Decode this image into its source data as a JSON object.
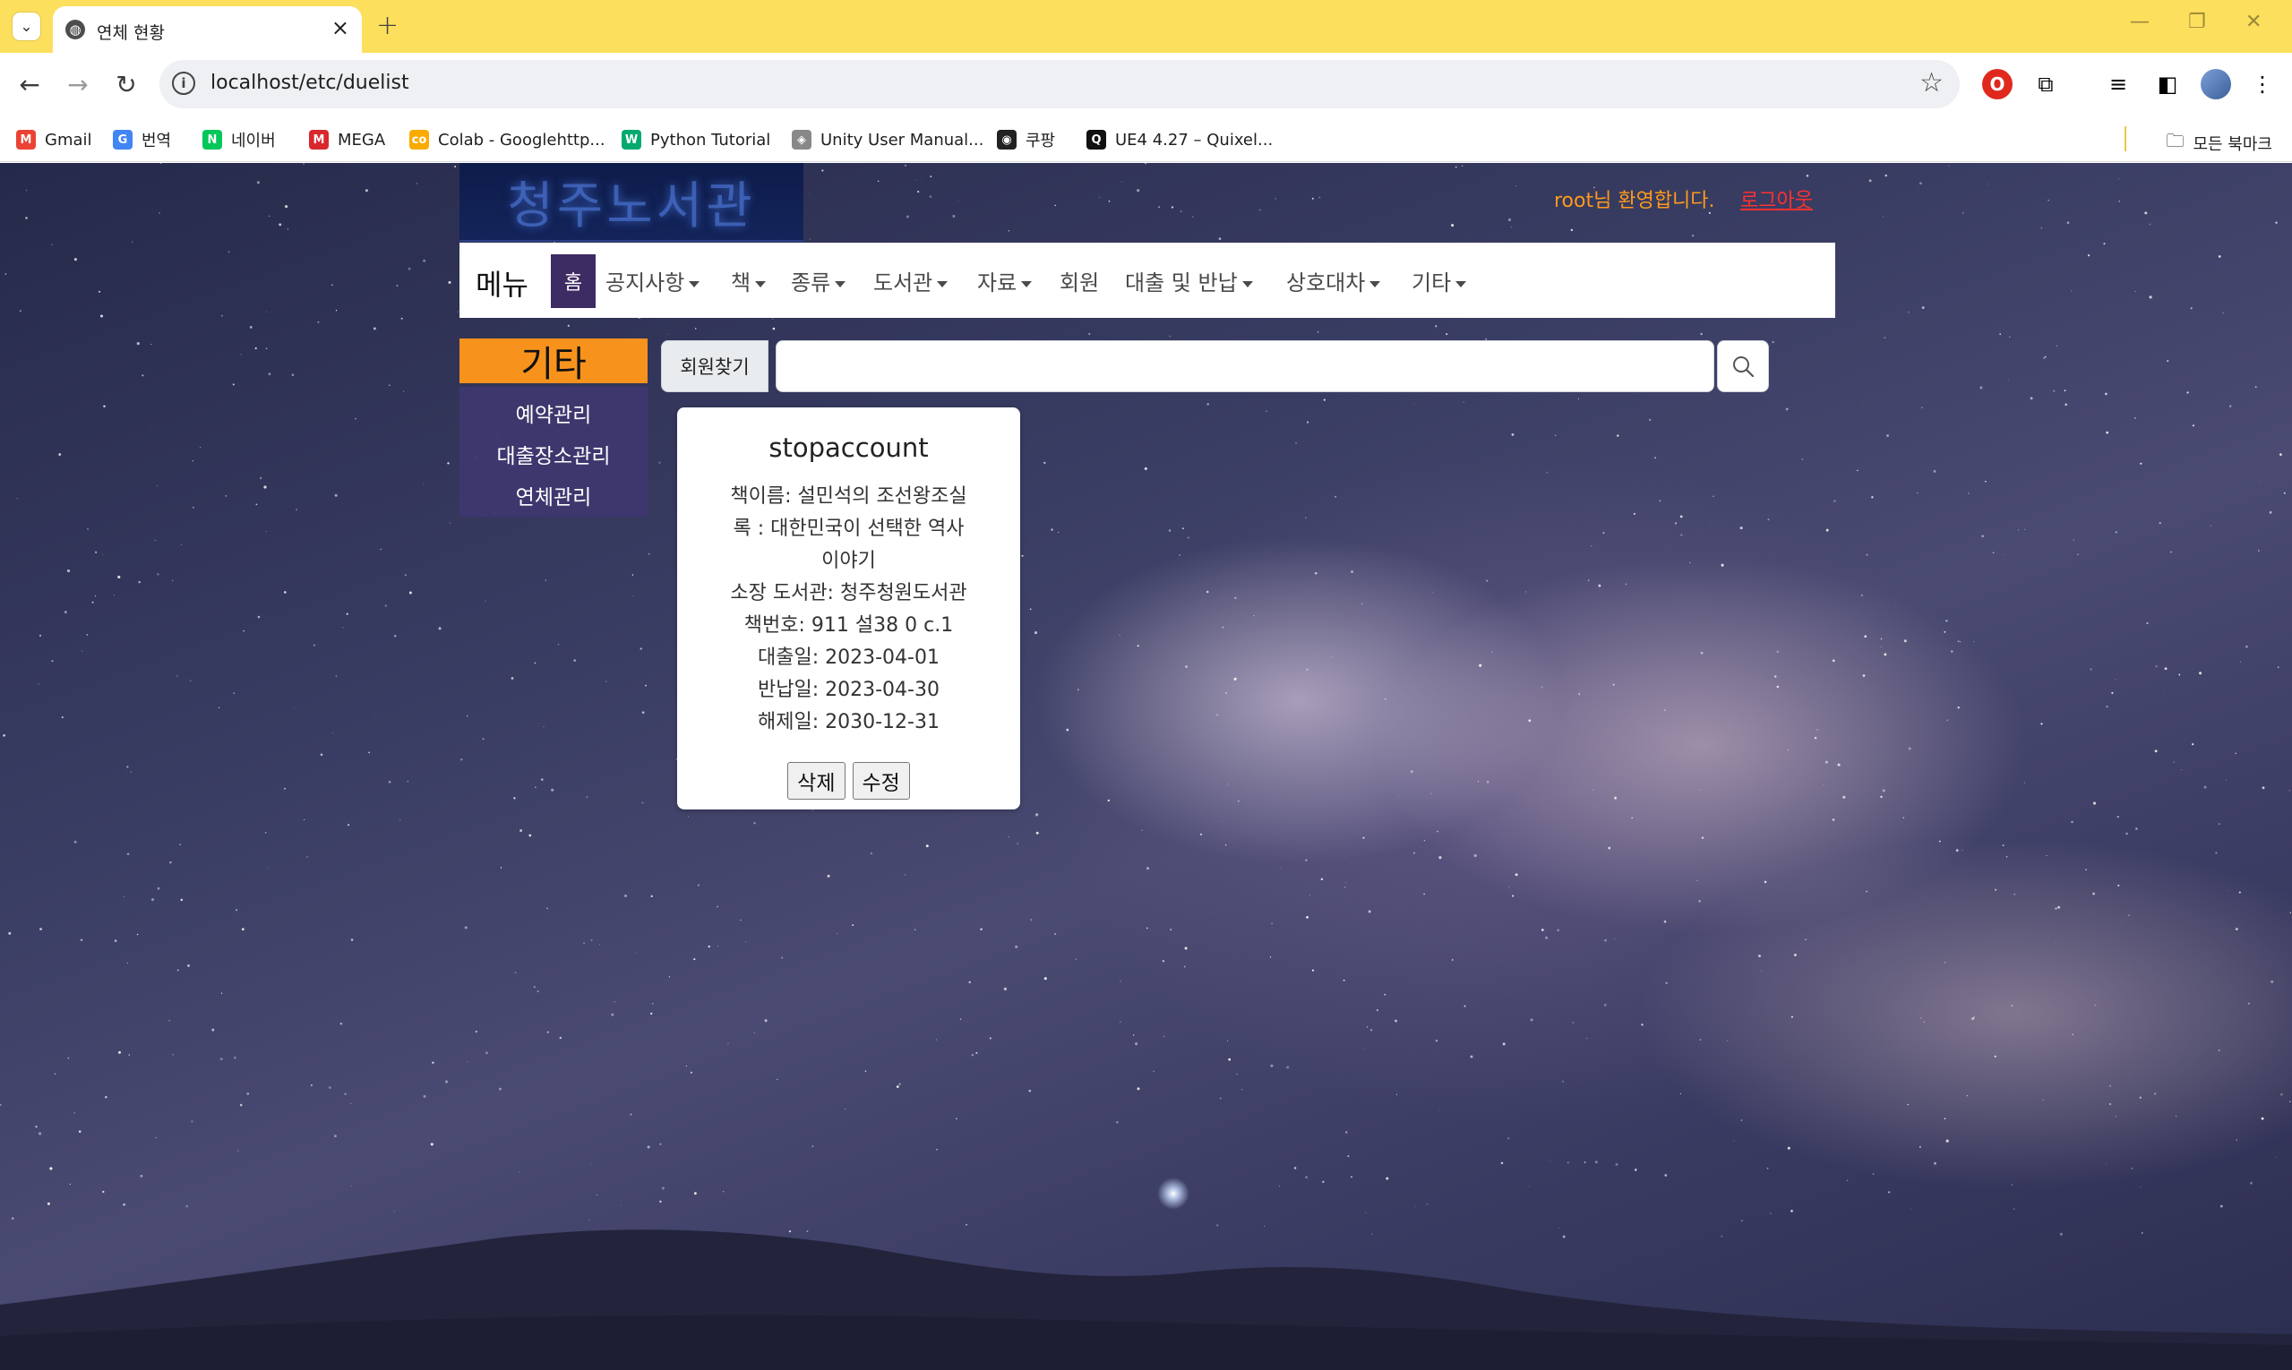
{
  "browser": {
    "tab_title": "연체 현황",
    "url": "localhost/etc/duelist",
    "bookmarks": [
      {
        "label": "Gmail",
        "icon": "gmail-icon",
        "color": "#ea4335",
        "glyph": "M"
      },
      {
        "label": "번역",
        "icon": "translate-icon",
        "color": "#4285f4",
        "glyph": "G"
      },
      {
        "label": "네이버",
        "icon": "naver-icon",
        "color": "#03c75a",
        "glyph": "N"
      },
      {
        "label": "MEGA",
        "icon": "mega-icon",
        "color": "#d9272e",
        "glyph": "M"
      },
      {
        "label": "Colab - Googlehttp...",
        "icon": "colab-icon",
        "color": "#f9ab00",
        "glyph": "co"
      },
      {
        "label": "Python Tutorial",
        "icon": "w3schools-icon",
        "color": "#04aa6d",
        "glyph": "W"
      },
      {
        "label": "Unity User Manual...",
        "icon": "unity-icon",
        "color": "#888888",
        "glyph": "◈"
      },
      {
        "label": "쿠팡",
        "icon": "globe-icon",
        "color": "#222222",
        "glyph": "◉"
      },
      {
        "label": "UE4 4.27 – Quixel...",
        "icon": "quixel-icon",
        "color": "#111111",
        "glyph": "Q"
      }
    ],
    "all_bookmarks_label": "모든 북마크"
  },
  "site": {
    "logo_text": "청주노서관",
    "welcome": "root님 환영합니다.",
    "logout": "로그아웃",
    "nav": {
      "brand": "메뉴",
      "home": "홈",
      "items": [
        {
          "label": "공지사항",
          "dropdown": true
        },
        {
          "label": "책",
          "dropdown": true
        },
        {
          "label": "종류",
          "dropdown": true
        },
        {
          "label": "도서관",
          "dropdown": true
        },
        {
          "label": "자료",
          "dropdown": true
        },
        {
          "label": "회원",
          "dropdown": false
        },
        {
          "label": "대출 및 반납",
          "dropdown": true
        },
        {
          "label": "상호대차",
          "dropdown": true
        },
        {
          "label": "기타",
          "dropdown": true
        }
      ]
    },
    "sidebar": {
      "title": "기타",
      "items": [
        "예약관리",
        "대출장소관리",
        "연체관리"
      ]
    },
    "search": {
      "label": "회원찾기",
      "value": "",
      "placeholder": ""
    },
    "card": {
      "title": "stopaccount",
      "lines": [
        "책이름: 설민석의 조선왕조실",
        "록 : 대한민국이 선택한 역사",
        "이야기",
        "소장 도서관: 청주청원도서관",
        "책번호: 911 설38 0 c.1",
        "대출일: 2023-04-01",
        "반납일: 2023-04-30",
        "해제일: 2030-12-31"
      ],
      "delete_label": "삭제",
      "edit_label": "수정"
    },
    "colors": {
      "accent_orange": "#f7931d",
      "nav_active": "#3d2b63",
      "welcome": "#ff9a1a",
      "logout": "#ff3030"
    }
  }
}
